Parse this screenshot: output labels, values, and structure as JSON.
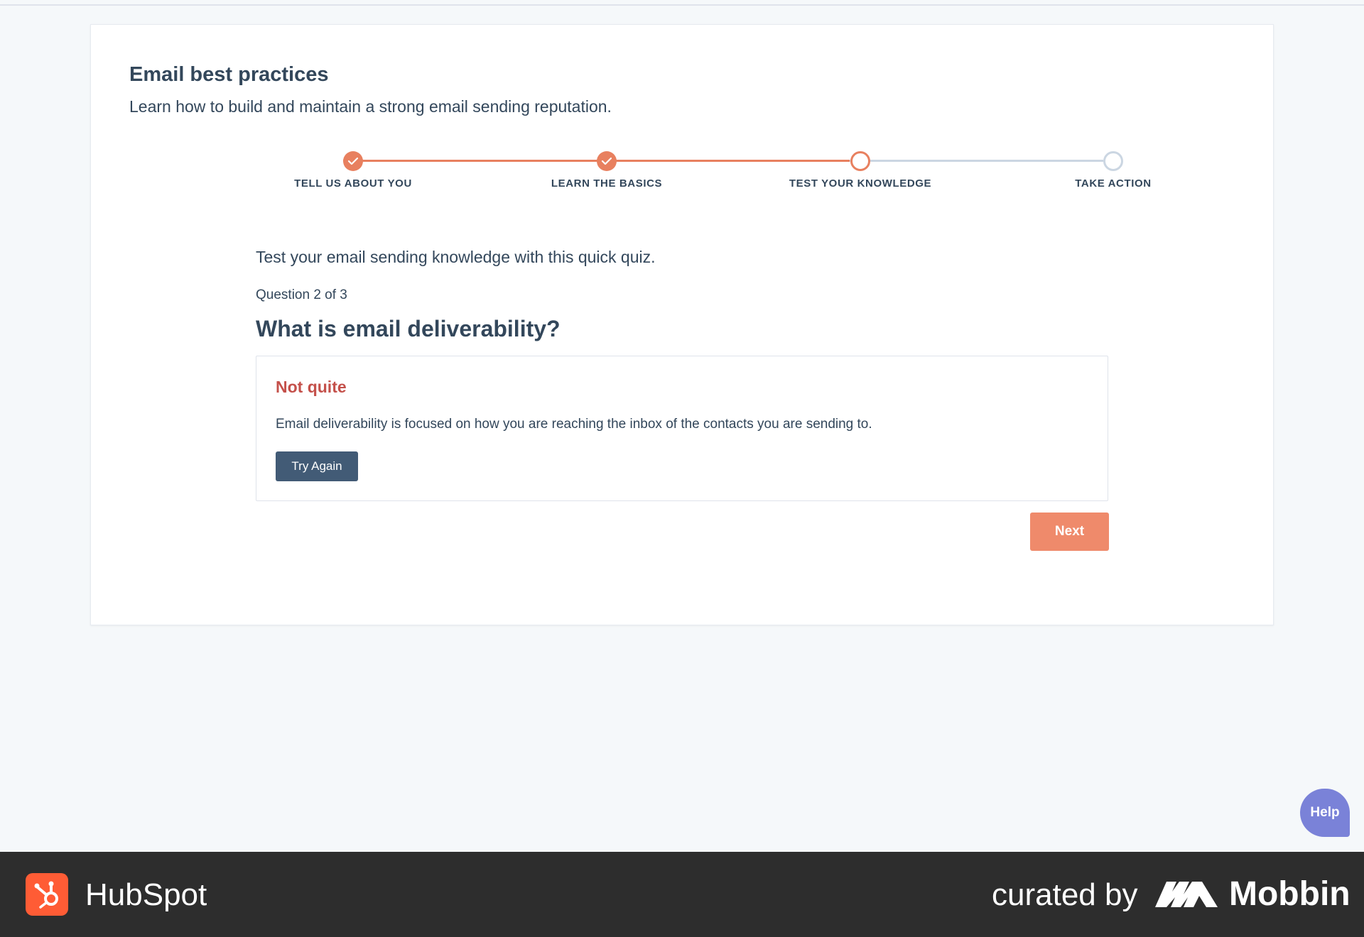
{
  "card": {
    "title": "Email best practices",
    "subtitle": "Learn how to build and maintain a strong email sending reputation."
  },
  "stepper": {
    "steps": [
      {
        "label": "TELL US ABOUT YOU",
        "state": "complete"
      },
      {
        "label": "LEARN THE BASICS",
        "state": "complete"
      },
      {
        "label": "TEST YOUR KNOWLEDGE",
        "state": "active"
      },
      {
        "label": "TAKE ACTION",
        "state": "pending"
      }
    ]
  },
  "quiz": {
    "intro": "Test your email sending knowledge with this quick quiz.",
    "counter": "Question 2 of 3",
    "question": "What is email deliverability?",
    "feedback": {
      "title": "Not quite",
      "text": "Email deliverability is focused on how you are reaching the inbox of the contacts you are sending to.",
      "retry_label": "Try Again"
    },
    "next_label": "Next"
  },
  "help": {
    "label": "Help"
  },
  "footer": {
    "brand": "HubSpot",
    "curated_label": "curated by",
    "curator": "Mobbin"
  },
  "colors": {
    "accent": "#e8805f",
    "primary_button": "#ef8a6b",
    "secondary_button": "#425b76",
    "error_text": "#c4504a",
    "help_button": "#7a82d8",
    "footer_bg": "#2d2d2d",
    "hubspot_orange": "#ff5c35"
  }
}
